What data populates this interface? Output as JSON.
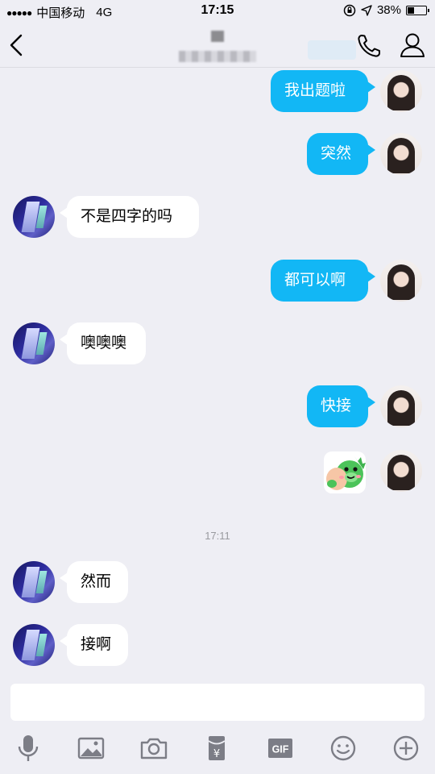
{
  "status_bar": {
    "carrier": "中国移动",
    "network": "4G",
    "time": "17:15",
    "battery": "38%",
    "battery_level": 0.38
  },
  "header": {
    "back_icon": "chevron-left-icon",
    "call_icon": "phone-icon",
    "profile_icon": "person-icon"
  },
  "messages": [
    {
      "side": "me",
      "text": "我出题啦"
    },
    {
      "side": "me",
      "text": "突然"
    },
    {
      "side": "friend",
      "text": "不是四字的吗"
    },
    {
      "side": "me",
      "text": "都可以啊"
    },
    {
      "side": "friend",
      "text": "噢噢噢"
    },
    {
      "side": "me",
      "text": "快接"
    },
    {
      "side": "me",
      "type": "sticker",
      "sticker": "green-dinosaur-sticker"
    },
    {
      "side": "friend",
      "text": "然而"
    },
    {
      "side": "friend",
      "text": "接啊"
    }
  ],
  "timestamp": "17:11",
  "input": {
    "value": "",
    "placeholder": ""
  },
  "toolbar": {
    "icons": [
      "microphone-icon",
      "image-icon",
      "camera-icon",
      "red-packet-icon",
      "gif-icon",
      "emoji-icon",
      "plus-icon"
    ],
    "gif_label": "GIF",
    "red_packet_label": "¥"
  },
  "colors": {
    "bubble_me": "#12b7f5",
    "bubble_friend": "#ffffff",
    "background": "#eeeef4",
    "icon_gray": "#7c7d86"
  }
}
